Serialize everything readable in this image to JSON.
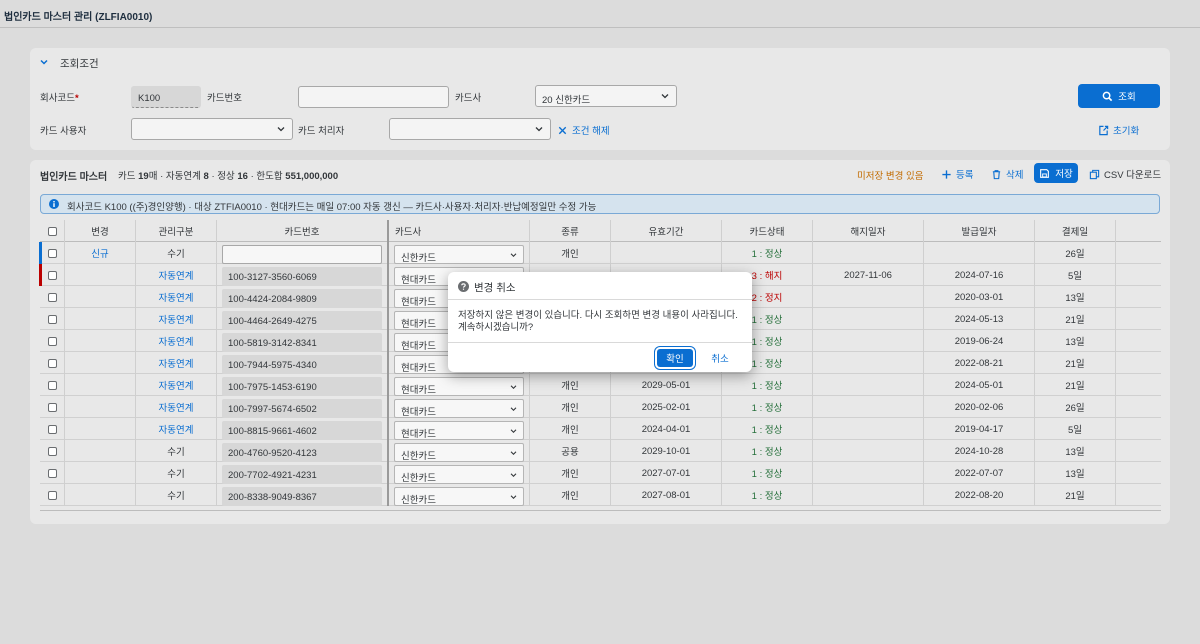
{
  "app": {
    "title": "법인카드 마스터 관리 (ZLFIA0010)"
  },
  "filter": {
    "title": "조회조건",
    "company_code_label": "회사코드",
    "required_mark": "*",
    "company_code_value": "K100",
    "card_number_label": "카드번호",
    "card_number_value": "",
    "card_company_label": "카드사",
    "card_company_value": "20 신한카드",
    "search_button": "조회",
    "card_user_label": "카드 사용자",
    "card_user_value": "",
    "card_handler_label": "카드 처리자",
    "card_handler_value": "",
    "clear_conditions": "조건 해제",
    "reset_button": "초기화"
  },
  "table": {
    "title": "법인카드 마스터",
    "stats": {
      "cards_label": "카드",
      "cards": "19",
      "cards_unit": "매",
      "auto_label": "자동연계",
      "auto": "8",
      "normal_label": "정상",
      "normal": "16",
      "limit_label": "한도합",
      "limit": "551,000,000",
      "sep": "·"
    },
    "unsaved_text": "미저장 변경 있음",
    "toolbar": {
      "add": "등록",
      "delete": "삭제",
      "save": "저장",
      "csv": "CSV 다운로드"
    },
    "info_text": "회사코드 K100 ((주)경인양행) · 대상 ZTFIA0010 · 현대카드는 매일 07:00 자동 갱신 — 카드사·사용자·처리자·반납예정일만 수정 가능",
    "columns": [
      "변경",
      "관리구분",
      "카드번호",
      "카드사",
      "종류",
      "유효기간",
      "카드상태",
      "해지일자",
      "발급일자",
      "결제일"
    ],
    "rows": [
      {
        "change": "신규",
        "mgmt": "수기",
        "card_no": "",
        "company": "신한카드",
        "type": "개인",
        "valid": "",
        "status": "1 : 정상",
        "cancel": "",
        "issue": "",
        "pay": "26일"
      },
      {
        "change": "",
        "mgmt": "자동연계",
        "card_no": "100-3127-3560-6069",
        "company": "현대카드",
        "type": "",
        "valid": "",
        "status": "3 : 해지",
        "cancel": "2027-11-06",
        "issue": "2024-07-16",
        "pay": "5일"
      },
      {
        "change": "",
        "mgmt": "자동연계",
        "card_no": "100-4424-2084-9809",
        "company": "현대카드",
        "type": "",
        "valid": "",
        "status": "2 : 정지",
        "cancel": "",
        "issue": "2020-03-01",
        "pay": "13일"
      },
      {
        "change": "",
        "mgmt": "자동연계",
        "card_no": "100-4464-2649-4275",
        "company": "현대카드",
        "type": "",
        "valid": "",
        "status": "1 : 정상",
        "cancel": "",
        "issue": "2024-05-13",
        "pay": "21일"
      },
      {
        "change": "",
        "mgmt": "자동연계",
        "card_no": "100-5819-3142-8341",
        "company": "현대카드",
        "type": "",
        "valid": "",
        "status": "1 : 정상",
        "cancel": "",
        "issue": "2019-06-24",
        "pay": "13일"
      },
      {
        "change": "",
        "mgmt": "자동연계",
        "card_no": "100-7944-5975-4340",
        "company": "현대카드",
        "type": "",
        "valid": "",
        "status": "1 : 정상",
        "cancel": "",
        "issue": "2022-08-21",
        "pay": "21일"
      },
      {
        "change": "",
        "mgmt": "자동연계",
        "card_no": "100-7975-1453-6190",
        "company": "현대카드",
        "type": "개인",
        "valid": "2029-05-01",
        "status": "1 : 정상",
        "cancel": "",
        "issue": "2024-05-01",
        "pay": "21일"
      },
      {
        "change": "",
        "mgmt": "자동연계",
        "card_no": "100-7997-5674-6502",
        "company": "현대카드",
        "type": "개인",
        "valid": "2025-02-01",
        "status": "1 : 정상",
        "cancel": "",
        "issue": "2020-02-06",
        "pay": "26일"
      },
      {
        "change": "",
        "mgmt": "자동연계",
        "card_no": "100-8815-9661-4602",
        "company": "현대카드",
        "type": "개인",
        "valid": "2024-04-01",
        "status": "1 : 정상",
        "cancel": "",
        "issue": "2019-04-17",
        "pay": "5일"
      },
      {
        "change": "",
        "mgmt": "수기",
        "card_no": "200-4760-9520-4123",
        "company": "신한카드",
        "type": "공용",
        "valid": "2029-10-01",
        "status": "1 : 정상",
        "cancel": "",
        "issue": "2024-10-28",
        "pay": "13일"
      },
      {
        "change": "",
        "mgmt": "수기",
        "card_no": "200-7702-4921-4231",
        "company": "신한카드",
        "type": "개인",
        "valid": "2027-07-01",
        "status": "1 : 정상",
        "cancel": "",
        "issue": "2022-07-07",
        "pay": "13일"
      },
      {
        "change": "",
        "mgmt": "수기",
        "card_no": "200-8338-9049-8367",
        "company": "신한카드",
        "type": "개인",
        "valid": "2027-08-01",
        "status": "1 : 정상",
        "cancel": "",
        "issue": "2022-08-20",
        "pay": "21일"
      }
    ]
  },
  "dialog": {
    "title": "변경 취소",
    "message_line1": "저장하지 않은 변경이 있습니다. 다시 조회하면 변경 내용이 사라집니다.",
    "message_line2": "계속하시겠습니까?",
    "confirm": "확인",
    "cancel": "취소"
  },
  "colors": {
    "accent": "#0a6ed1",
    "error": "#bb0000",
    "success": "#256f3a",
    "warning": "#c26b00",
    "row_new_marker": "#0a6ed1",
    "row_error_marker": "#bb0000"
  }
}
